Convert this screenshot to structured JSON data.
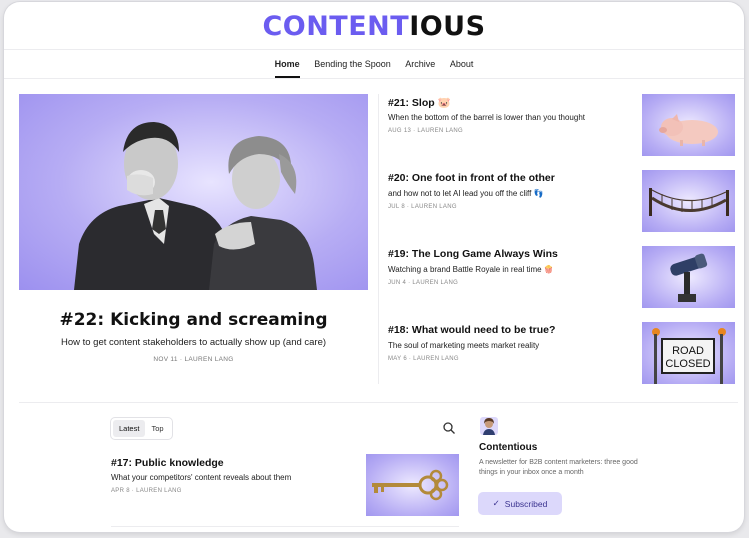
{
  "brand": {
    "logo_part1": "CONTENT",
    "logo_part2": "IOUS",
    "accent": "#6b5cf0"
  },
  "nav": {
    "items": [
      "Home",
      "Bending the Spoon",
      "Archive",
      "About"
    ],
    "active": "Home"
  },
  "hero": {
    "title": "#22: Kicking and screaming",
    "subtitle": "How to get content stakeholders to actually show up (and care)",
    "meta": "NOV 11 · LAUREN LANG"
  },
  "posts": [
    {
      "title": "#21: Slop 🐷",
      "subtitle": "When the bottom of the barrel is lower than you thought",
      "meta": "AUG 13 · LAUREN LANG",
      "thumb": "pig-image"
    },
    {
      "title": "#20: One foot in front of the other",
      "subtitle": "and how not to let AI lead you off the cliff 👣",
      "meta": "JUL 8 · LAUREN LANG",
      "thumb": "rope-bridge-image"
    },
    {
      "title": "#19: The Long Game Always Wins",
      "subtitle": "Watching a brand Battle Royale in real time 🍿",
      "meta": "JUN 4 · LAUREN LANG",
      "thumb": "telescope-image"
    },
    {
      "title": "#18: What would need to be true?",
      "subtitle": "The soul of marketing meets market reality",
      "meta": "MAY 6 · LAUREN LANG",
      "thumb": "road-closed-sign-image"
    }
  ],
  "road_sign": {
    "line1": "ROAD",
    "line2": "CLOSED"
  },
  "feed": {
    "tabs": [
      "Latest",
      "Top"
    ],
    "active_tab": "Latest",
    "post": {
      "title": "#17: Public knowledge",
      "subtitle": "What your competitors' content reveals about them",
      "meta": "APR 8 · LAUREN LANG"
    }
  },
  "publication": {
    "name": "Contentious",
    "description": "A newsletter for B2B content marketers: three good things in your inbox once a month",
    "button_label": "Subscribed"
  }
}
